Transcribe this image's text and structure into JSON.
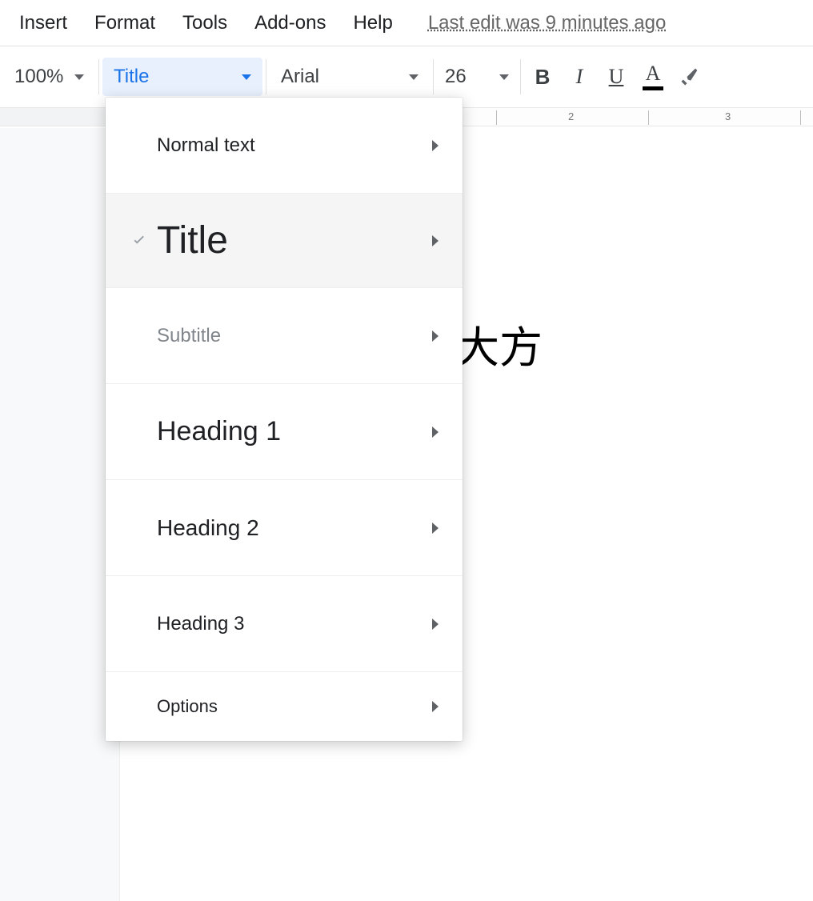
{
  "menubar": {
    "items": [
      "Insert",
      "Format",
      "Tools",
      "Add-ons",
      "Help"
    ],
    "last_edit": "Last edit was 9 minutes ago"
  },
  "toolbar": {
    "zoom": "100%",
    "style_selected": "Title",
    "font": "Arial",
    "font_size": "26",
    "bold": "B",
    "italic": "I",
    "underline": "U",
    "text_color_letter": "A"
  },
  "ruler": {
    "marks": [
      "2",
      "3"
    ]
  },
  "document": {
    "visible_text": "大方"
  },
  "style_menu": {
    "items": [
      {
        "label": "Normal text",
        "selected": false
      },
      {
        "label": "Title",
        "selected": true
      },
      {
        "label": "Subtitle",
        "selected": false
      },
      {
        "label": "Heading 1",
        "selected": false
      },
      {
        "label": "Heading 2",
        "selected": false
      },
      {
        "label": "Heading 3",
        "selected": false
      },
      {
        "label": "Options",
        "selected": false
      }
    ]
  }
}
